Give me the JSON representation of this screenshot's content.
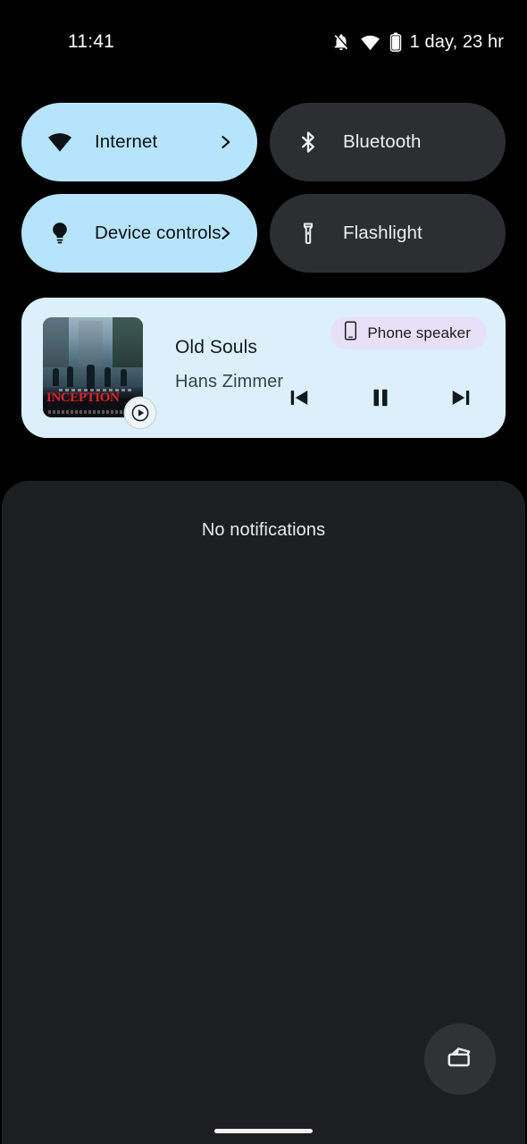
{
  "status_bar": {
    "time": "11:41",
    "battery_text": "1 day, 23 hr",
    "icons": [
      "notifications-off-icon",
      "wifi-icon",
      "battery-icon"
    ]
  },
  "quick_settings": {
    "tiles": [
      {
        "label": "Internet",
        "icon": "wifi-icon",
        "state": "on",
        "has_chevron": true
      },
      {
        "label": "Bluetooth",
        "icon": "bluetooth-icon",
        "state": "off",
        "has_chevron": false
      },
      {
        "label": "Device controls",
        "icon": "lightbulb-icon",
        "state": "on",
        "has_chevron": true
      },
      {
        "label": "Flashlight",
        "icon": "flashlight-icon",
        "state": "off",
        "has_chevron": false
      }
    ]
  },
  "media_player": {
    "title": "Old Souls",
    "artist": "Hans Zimmer",
    "album_art_text": "INCEPTION",
    "output_device": "Phone speaker",
    "output_icon": "phone-icon",
    "app_badge_icon": "play-badge-icon",
    "controls": [
      {
        "name": "previous-button",
        "icon": "skip-previous-icon"
      },
      {
        "name": "pause-button",
        "icon": "pause-icon"
      },
      {
        "name": "next-button",
        "icon": "skip-next-icon"
      }
    ]
  },
  "notification_shade": {
    "empty_text": "No notifications",
    "clear_all_icon": "clear-all-icon"
  },
  "colors": {
    "background": "#000000",
    "tile_on": "#b5e4fb",
    "tile_off": "#2c2f31",
    "media_card": "#dcf0fb",
    "chip": "#e7e1f7",
    "shade": "#1c1f22"
  }
}
